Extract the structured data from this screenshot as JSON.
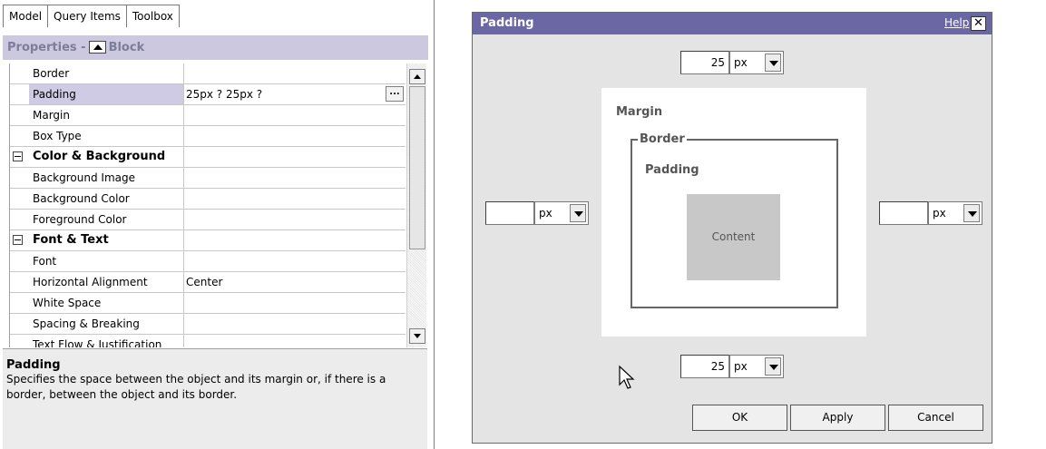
{
  "tabs": [
    "Model",
    "Query Items",
    "Toolbox"
  ],
  "properties_header": {
    "prefix": "Properties -",
    "object": "Block"
  },
  "properties": [
    {
      "name": "Border",
      "value": "",
      "kind": "row"
    },
    {
      "name": "Padding",
      "value": "25px ? 25px ?",
      "kind": "row",
      "selected": true,
      "has_ellipsis": true,
      "ellipsis_label": "..."
    },
    {
      "name": "Margin",
      "value": "",
      "kind": "row"
    },
    {
      "name": "Box Type",
      "value": "",
      "kind": "row"
    },
    {
      "name": "Color & Background",
      "value": "",
      "kind": "category"
    },
    {
      "name": "Background Image",
      "value": "",
      "kind": "row"
    },
    {
      "name": "Background Color",
      "value": "",
      "kind": "row"
    },
    {
      "name": "Foreground Color",
      "value": "",
      "kind": "row"
    },
    {
      "name": "Font & Text",
      "value": "",
      "kind": "category"
    },
    {
      "name": "Font",
      "value": "",
      "kind": "row"
    },
    {
      "name": "Horizontal Alignment",
      "value": "Center",
      "kind": "row"
    },
    {
      "name": "White Space",
      "value": "",
      "kind": "row"
    },
    {
      "name": "Spacing & Breaking",
      "value": "",
      "kind": "row"
    },
    {
      "name": "Text Flow & Justification",
      "value": "",
      "kind": "row"
    }
  ],
  "description": {
    "title": "Padding",
    "text": "Specifies the space between the object and its margin or, if there is a border, between the object and its border."
  },
  "dialog": {
    "title": "Padding",
    "help": "Help",
    "close": "✕",
    "top": {
      "value": "25",
      "unit": "px"
    },
    "left": {
      "value": "",
      "unit": "px"
    },
    "right": {
      "value": "",
      "unit": "px"
    },
    "bottom": {
      "value": "25",
      "unit": "px"
    },
    "diagram": {
      "margin": "Margin",
      "border": "Border",
      "padding": "Padding",
      "content": "Content"
    },
    "buttons": {
      "ok": "OK",
      "apply": "Apply",
      "cancel": "Cancel"
    }
  },
  "colors": {
    "title_bar": "#6b67a4",
    "header_band": "#ccc8e0",
    "selected_row": "#cfcbe4"
  }
}
